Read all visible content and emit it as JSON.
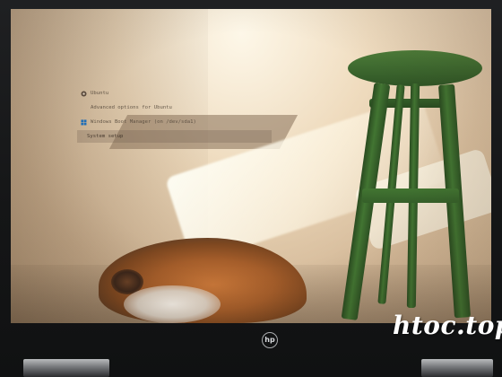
{
  "boot_menu": {
    "items": [
      {
        "label": "Ubuntu",
        "icon": "ubuntu-circle-icon"
      },
      {
        "label": "Advanced options for Ubuntu"
      },
      {
        "label": "Windows Boot Manager (on /dev/sda1)",
        "icon": "windows-logo-icon"
      },
      {
        "label": "System setup"
      }
    ],
    "selected_index": 3
  },
  "device": {
    "logo_text": "hp"
  },
  "watermark": {
    "text": "htoc.top"
  },
  "colors": {
    "screen_highlight": "#f6ead4",
    "stool_green": "#427532",
    "cat_orange": "#a45d2a",
    "selection_bar": "#6e5e4e"
  }
}
